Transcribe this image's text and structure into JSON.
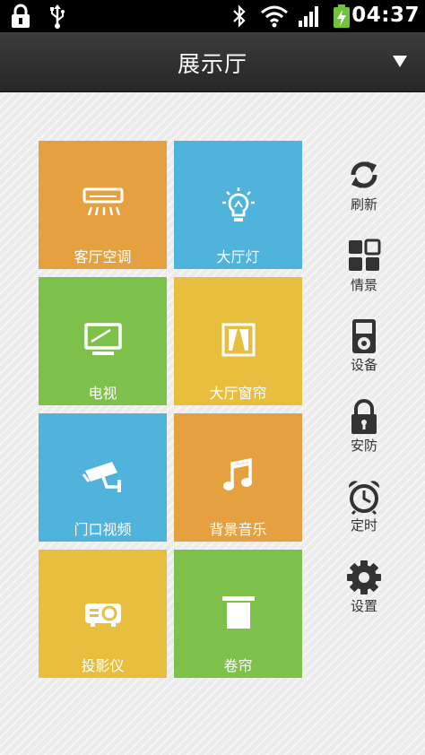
{
  "status_bar": {
    "time": "04:37",
    "icons": [
      "lock-icon",
      "usb-icon",
      "bluetooth-icon",
      "wifi-icon",
      "signal-icon",
      "battery-charging-icon"
    ]
  },
  "header": {
    "title": "展示厅",
    "dropdown_icon": "triangle-down-icon"
  },
  "tiles": [
    {
      "label": "客厅空调",
      "icon": "air-conditioner-icon",
      "color": "#E5A13F"
    },
    {
      "label": "大厅灯",
      "icon": "light-bulb-icon",
      "color": "#4FB3DC"
    },
    {
      "label": "电视",
      "icon": "tv-icon",
      "color": "#7DC04A"
    },
    {
      "label": "大厅窗帘",
      "icon": "curtain-icon",
      "color": "#E8BE3F"
    },
    {
      "label": "门口视频",
      "icon": "security-camera-icon",
      "color": "#4FB3DC"
    },
    {
      "label": "背景音乐",
      "icon": "music-note-icon",
      "color": "#E5A13F"
    },
    {
      "label": "投影仪",
      "icon": "projector-icon",
      "color": "#E8BE3F"
    },
    {
      "label": "卷帘",
      "icon": "roller-blind-icon",
      "color": "#7DC04A"
    }
  ],
  "side_menu": [
    {
      "label": "刷新",
      "icon": "refresh-icon"
    },
    {
      "label": "情景",
      "icon": "scene-grid-icon"
    },
    {
      "label": "设备",
      "icon": "device-icon"
    },
    {
      "label": "安防",
      "icon": "padlock-icon"
    },
    {
      "label": "定时",
      "icon": "alarm-clock-icon"
    },
    {
      "label": "设置",
      "icon": "gear-icon"
    }
  ]
}
